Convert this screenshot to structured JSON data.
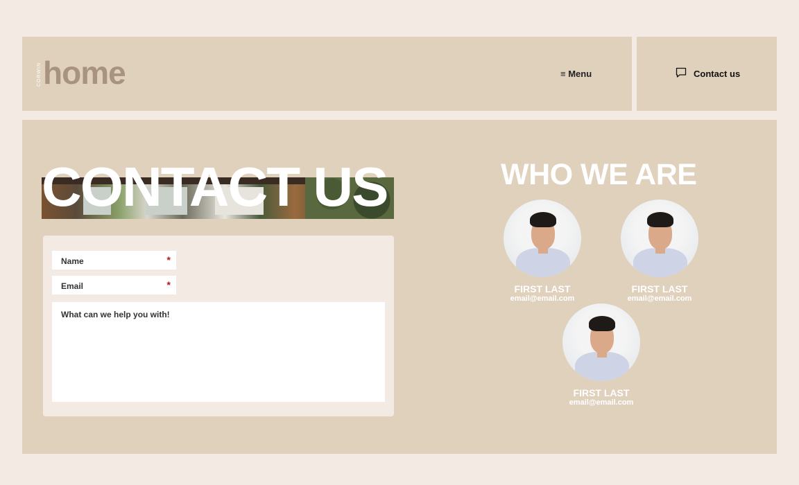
{
  "header": {
    "logo_small": "CORWIN",
    "logo_big": "home",
    "menu_label": "≡ Menu",
    "contact_label": "Contact us",
    "contact_icon": "chat-bubble-icon"
  },
  "hero": {
    "title": "CONTACT US"
  },
  "form": {
    "name_label": "Name",
    "email_label": "Email",
    "message_label": "What can we help you with!",
    "required_marker": "*"
  },
  "who": {
    "title": "WHO WE ARE",
    "members": [
      {
        "name": "FIRST LAST",
        "email": "email@email.com"
      },
      {
        "name": "FIRST LAST",
        "email": "email@email.com"
      },
      {
        "name": "FIRST LAST",
        "email": "email@email.com"
      }
    ]
  },
  "colors": {
    "background": "#f3ebe3",
    "panel": "#e0d1bd",
    "logo": "#a89380",
    "required": "#c0161b"
  }
}
